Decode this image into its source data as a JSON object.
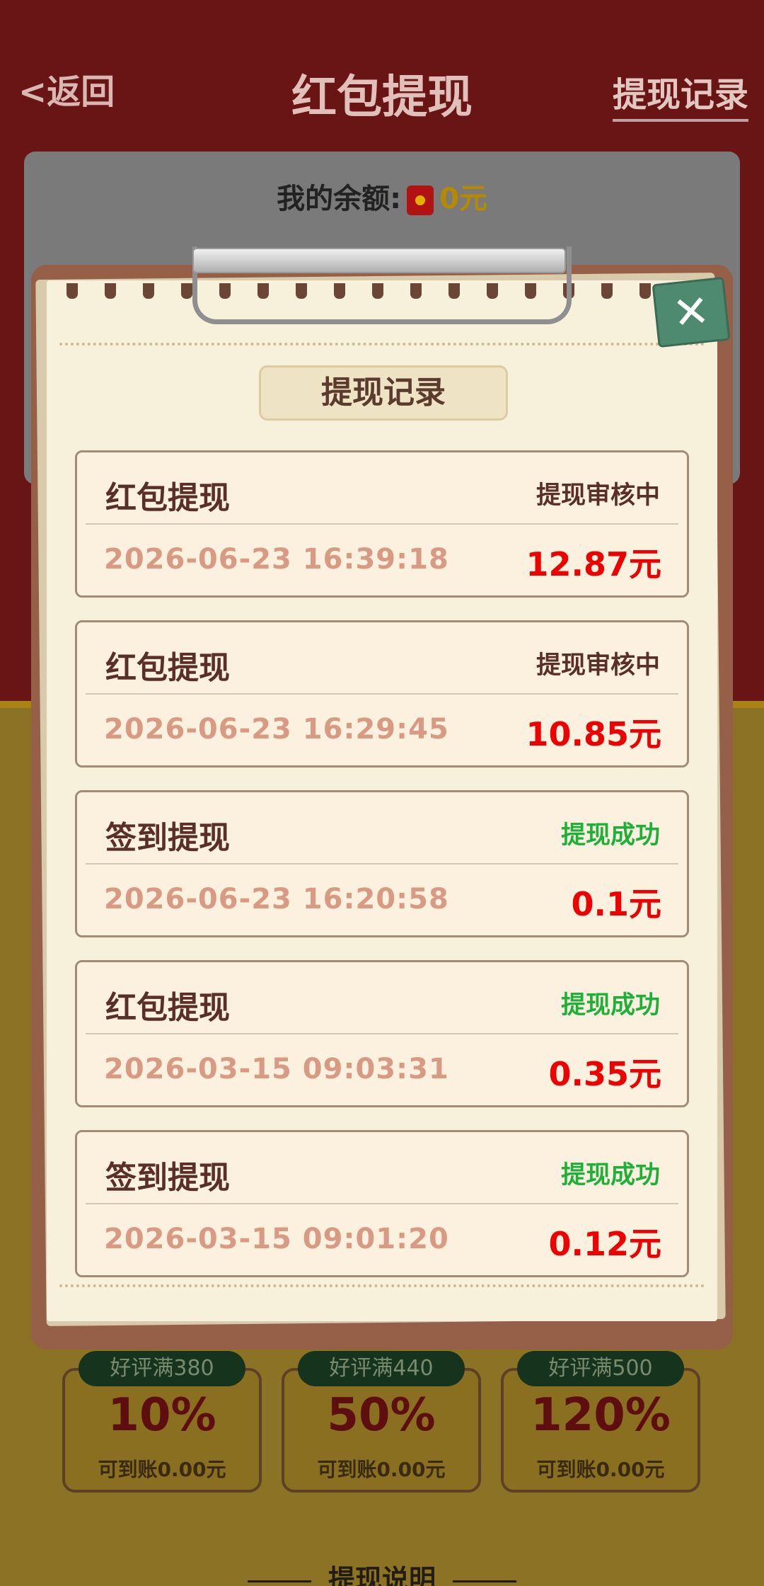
{
  "nav": {
    "back_label": "返回",
    "title": "红包提现",
    "history_link": "提现记录"
  },
  "balance": {
    "label": "我的余额:",
    "amount": "0元"
  },
  "tiers": [
    {
      "badge": "好评满380",
      "percent": "10%",
      "sub": "可到账0.00元"
    },
    {
      "badge": "好评满440",
      "percent": "50%",
      "sub": "可到账0.00元"
    },
    {
      "badge": "好评满500",
      "percent": "120%",
      "sub": "可到账0.00元"
    }
  ],
  "rules_heading": "提现说明",
  "modal": {
    "title": "提现记录",
    "close_label": "✕",
    "records": [
      {
        "type": "红包提现",
        "status": "提现审核中",
        "time": "2026-06-23 16:39:18",
        "amount": "12.87元"
      },
      {
        "type": "红包提现",
        "status": "提现审核中",
        "time": "2026-06-23 16:29:45",
        "amount": "10.85元"
      },
      {
        "type": "签到提现",
        "status": "提现成功",
        "time": "2026-06-23 16:20:58",
        "amount": "0.1元"
      },
      {
        "type": "红包提现",
        "status": "提现成功",
        "time": "2026-03-15 09:03:31",
        "amount": "0.35元"
      },
      {
        "type": "签到提现",
        "status": "提现成功",
        "time": "2026-03-15 09:01:20",
        "amount": "0.12元"
      }
    ]
  },
  "colors": {
    "status_pending": "#5a2f25",
    "status_success": "#1fb03a",
    "amount": "#ef0000"
  }
}
